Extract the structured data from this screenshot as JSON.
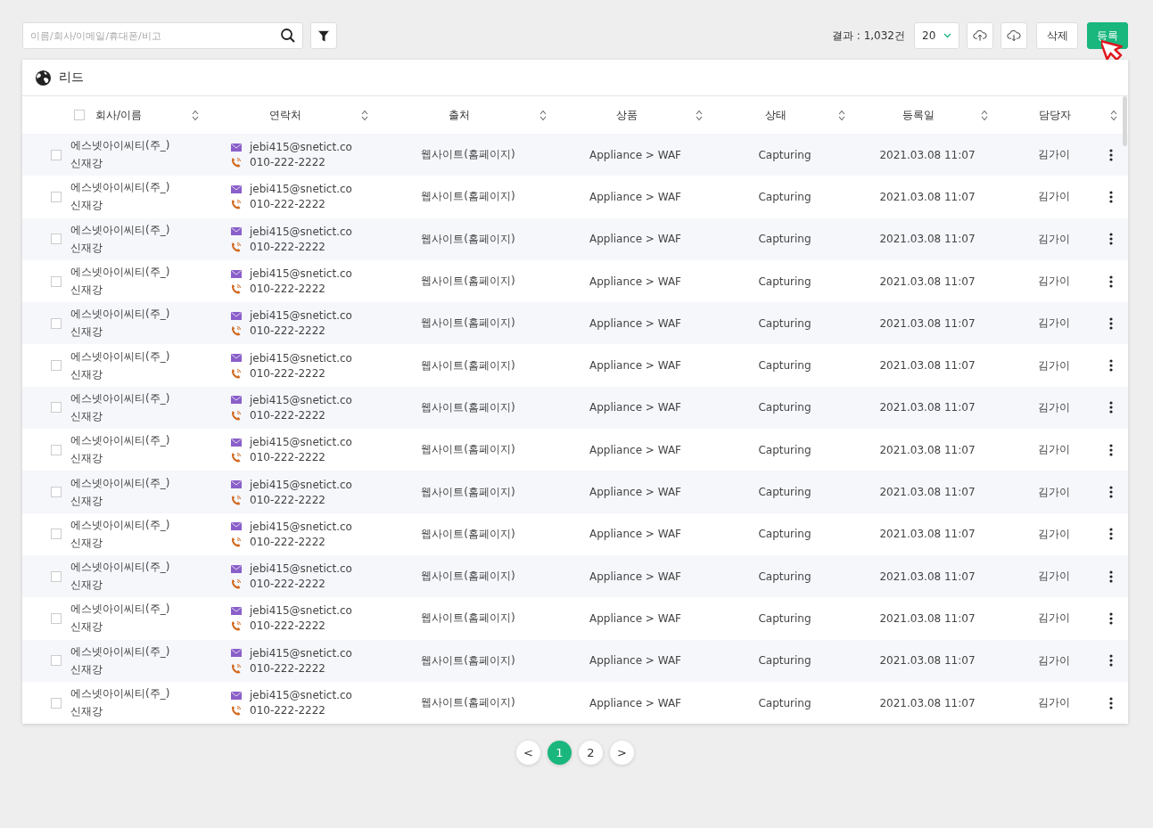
{
  "toolbar": {
    "search": {
      "placeholder": "이름/회사/이메일/휴대폰/비고"
    },
    "result_count": "결과 : 1,032건",
    "page_size": "20",
    "delete_button": "삭제",
    "register_button": "등록"
  },
  "card": {
    "title": "리드",
    "columns": [
      {
        "label": "회사/이름",
        "checked": false
      },
      {
        "label": "연락처"
      },
      {
        "label": "출처"
      },
      {
        "label": "상품"
      },
      {
        "label": "상태"
      },
      {
        "label": "등록일"
      },
      {
        "label": "담당자"
      }
    ],
    "rows": [
      {
        "checked": false,
        "company": "에스넷아이씨티(주_)",
        "name": "신재강",
        "email": "jebi415@snetict.co",
        "phone": "010-222-2222",
        "source": "웹사이트(홈페이지)",
        "product": "Appliance > WAF",
        "status": "Capturing",
        "date": "2021.03.08 11:07",
        "owner": "김가이"
      },
      {
        "checked": false,
        "company": "에스넷아이씨티(주_)",
        "name": "신재강",
        "email": "jebi415@snetict.co",
        "phone": "010-222-2222",
        "source": "웹사이트(홈페이지)",
        "product": "Appliance > WAF",
        "status": "Capturing",
        "date": "2021.03.08 11:07",
        "owner": "김가이"
      },
      {
        "checked": false,
        "company": "에스넷아이씨티(주_)",
        "name": "신재강",
        "email": "jebi415@snetict.co",
        "phone": "010-222-2222",
        "source": "웹사이트(홈페이지)",
        "product": "Appliance > WAF",
        "status": "Capturing",
        "date": "2021.03.08 11:07",
        "owner": "김가이"
      },
      {
        "checked": false,
        "company": "에스넷아이씨티(주_)",
        "name": "신재강",
        "email": "jebi415@snetict.co",
        "phone": "010-222-2222",
        "source": "웹사이트(홈페이지)",
        "product": "Appliance > WAF",
        "status": "Capturing",
        "date": "2021.03.08 11:07",
        "owner": "김가이"
      },
      {
        "checked": false,
        "company": "에스넷아이씨티(주_)",
        "name": "신재강",
        "email": "jebi415@snetict.co",
        "phone": "010-222-2222",
        "source": "웹사이트(홈페이지)",
        "product": "Appliance > WAF",
        "status": "Capturing",
        "date": "2021.03.08 11:07",
        "owner": "김가이"
      },
      {
        "checked": false,
        "company": "에스넷아이씨티(주_)",
        "name": "신재강",
        "email": "jebi415@snetict.co",
        "phone": "010-222-2222",
        "source": "웹사이트(홈페이지)",
        "product": "Appliance > WAF",
        "status": "Capturing",
        "date": "2021.03.08 11:07",
        "owner": "김가이"
      },
      {
        "checked": false,
        "company": "에스넷아이씨티(주_)",
        "name": "신재강",
        "email": "jebi415@snetict.co",
        "phone": "010-222-2222",
        "source": "웹사이트(홈페이지)",
        "product": "Appliance > WAF",
        "status": "Capturing",
        "date": "2021.03.08 11:07",
        "owner": "김가이"
      },
      {
        "checked": false,
        "company": "에스넷아이씨티(주_)",
        "name": "신재강",
        "email": "jebi415@snetict.co",
        "phone": "010-222-2222",
        "source": "웹사이트(홈페이지)",
        "product": "Appliance > WAF",
        "status": "Capturing",
        "date": "2021.03.08 11:07",
        "owner": "김가이"
      },
      {
        "checked": false,
        "company": "에스넷아이씨티(주_)",
        "name": "신재강",
        "email": "jebi415@snetict.co",
        "phone": "010-222-2222",
        "source": "웹사이트(홈페이지)",
        "product": "Appliance > WAF",
        "status": "Capturing",
        "date": "2021.03.08 11:07",
        "owner": "김가이"
      },
      {
        "checked": false,
        "company": "에스넷아이씨티(주_)",
        "name": "신재강",
        "email": "jebi415@snetict.co",
        "phone": "010-222-2222",
        "source": "웹사이트(홈페이지)",
        "product": "Appliance > WAF",
        "status": "Capturing",
        "date": "2021.03.08 11:07",
        "owner": "김가이"
      },
      {
        "checked": false,
        "company": "에스넷아이씨티(주_)",
        "name": "신재강",
        "email": "jebi415@snetict.co",
        "phone": "010-222-2222",
        "source": "웹사이트(홈페이지)",
        "product": "Appliance > WAF",
        "status": "Capturing",
        "date": "2021.03.08 11:07",
        "owner": "김가이"
      },
      {
        "checked": false,
        "company": "에스넷아이씨티(주_)",
        "name": "신재강",
        "email": "jebi415@snetict.co",
        "phone": "010-222-2222",
        "source": "웹사이트(홈페이지)",
        "product": "Appliance > WAF",
        "status": "Capturing",
        "date": "2021.03.08 11:07",
        "owner": "김가이"
      },
      {
        "checked": false,
        "company": "에스넷아이씨티(주_)",
        "name": "신재강",
        "email": "jebi415@snetict.co",
        "phone": "010-222-2222",
        "source": "웹사이트(홈페이지)",
        "product": "Appliance > WAF",
        "status": "Capturing",
        "date": "2021.03.08 11:07",
        "owner": "김가이"
      },
      {
        "checked": false,
        "company": "에스넷아이씨티(주_)",
        "name": "신재강",
        "email": "jebi415@snetict.co",
        "phone": "010-222-2222",
        "source": "웹사이트(홈페이지)",
        "product": "Appliance > WAF",
        "status": "Capturing",
        "date": "2021.03.08 11:07",
        "owner": "김가이"
      }
    ]
  },
  "pagination": {
    "prev": "<",
    "pages": [
      {
        "label": "1",
        "selected": true
      },
      {
        "label": "2",
        "selected": false
      }
    ],
    "next": ">"
  }
}
